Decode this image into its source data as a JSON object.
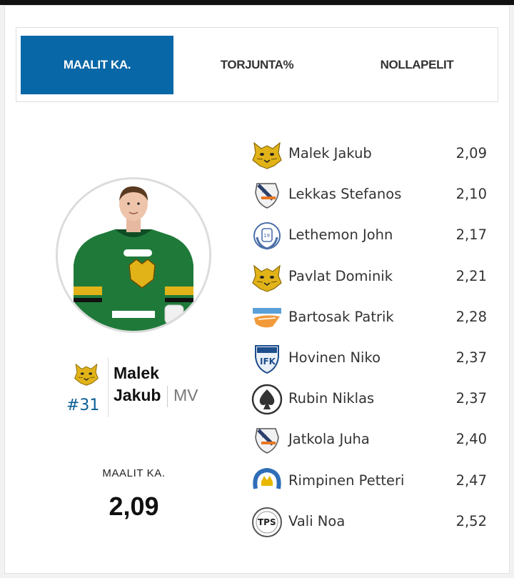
{
  "tabs": [
    {
      "label": "MAALIT KA.",
      "active": true
    },
    {
      "label": "TORJUNTA%",
      "active": false
    },
    {
      "label": "NOLLAPELIT",
      "active": false
    }
  ],
  "featured": {
    "first_name": "Malek",
    "last_name": "Jakub",
    "number": "#31",
    "position": "MV",
    "team_logo": "lynx-logo",
    "stat_label": "MAALIT KA.",
    "stat_value": "2,09",
    "jersey_color": "#1f7a3a"
  },
  "leaders": [
    {
      "name": "Malek Jakub",
      "value": "2,09",
      "logo": "lynx-logo"
    },
    {
      "name": "Lekkas Stefanos",
      "value": "2,10",
      "logo": "star-shield-logo"
    },
    {
      "name": "Lethemon John",
      "value": "2,17",
      "logo": "laurel-crest-logo"
    },
    {
      "name": "Pavlat Dominik",
      "value": "2,21",
      "logo": "lynx-logo"
    },
    {
      "name": "Bartosak Patrik",
      "value": "2,28",
      "logo": "pelicans-logo"
    },
    {
      "name": "Hovinen Niko",
      "value": "2,37",
      "logo": "ifk-shield-logo"
    },
    {
      "name": "Rubin Niklas",
      "value": "2,37",
      "logo": "spade-logo"
    },
    {
      "name": "Jatkola Juha",
      "value": "2,40",
      "logo": "star-shield-logo"
    },
    {
      "name": "Rimpinen Petteri",
      "value": "2,47",
      "logo": "horseshoe-crown-logo"
    },
    {
      "name": "Vali Noa",
      "value": "2,52",
      "logo": "tps-round-logo"
    }
  ],
  "colors": {
    "accent": "#0867a6",
    "number": "#0b5f96"
  }
}
